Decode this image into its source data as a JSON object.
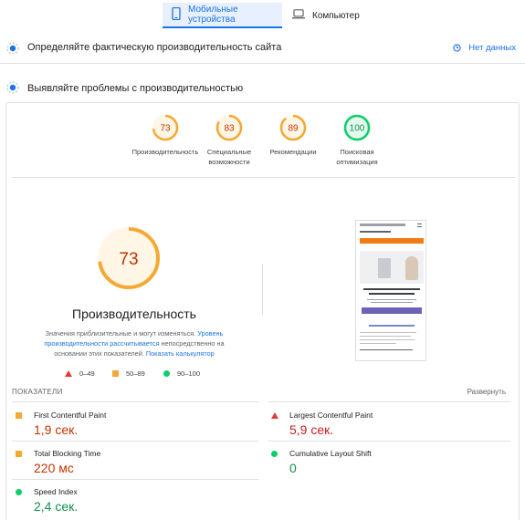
{
  "tabs": {
    "mobile_label": "Мобильные устройства",
    "desktop_label": "Компьютер"
  },
  "field_data": {
    "title": "Определяйте фактическую производительность сайта",
    "no_data_label": "Нет данных"
  },
  "lab_data": {
    "title": "Выявляйте проблемы с производительностью"
  },
  "categories": [
    {
      "score": "73",
      "label_line1": "Производительность",
      "label_line2": "",
      "color": "#f4a934",
      "fraction": 0.73
    },
    {
      "score": "83",
      "label_line1": "Специальные",
      "label_line2": "возможности",
      "color": "#f4a934",
      "fraction": 0.83
    },
    {
      "score": "89",
      "label_line1": "Рекомендации",
      "label_line2": "",
      "color": "#f4a934",
      "fraction": 0.89
    },
    {
      "score": "100",
      "label_line1": "Поисковая",
      "label_line2": "оптимизация",
      "color": "#0cce6b",
      "fraction": 1.0
    }
  ],
  "performance": {
    "score": "73",
    "title": "Производительность",
    "note_text1": "Значения приблизительные и могут изменяться.",
    "note_link1": "Уровень производительности рассчитывается",
    "note_text2": "непосредственно на основании этих показателей.",
    "note_link2": "Показать калькулятор"
  },
  "legend": {
    "fail": "0–49",
    "average": "50–89",
    "pass": "90–100"
  },
  "metrics_section": {
    "header": "ПОКАЗАТЕЛИ",
    "expand_label": "Развернуть"
  },
  "metrics": {
    "fcp": {
      "name": "First Contentful Paint",
      "value": "1,9 сек."
    },
    "lcp": {
      "name": "Largest Contentful Paint",
      "value": "5,9 сек."
    },
    "tbt": {
      "name": "Total Blocking Time",
      "value": "220 мс"
    },
    "cls": {
      "name": "Cumulative Layout Shift",
      "value": "0"
    },
    "si": {
      "name": "Speed Index",
      "value": "2,4 сек."
    }
  },
  "colors": {
    "accent": "#1a73e8",
    "pass": "#0cce6b",
    "average": "#f4a934",
    "fail": "#e53935"
  }
}
